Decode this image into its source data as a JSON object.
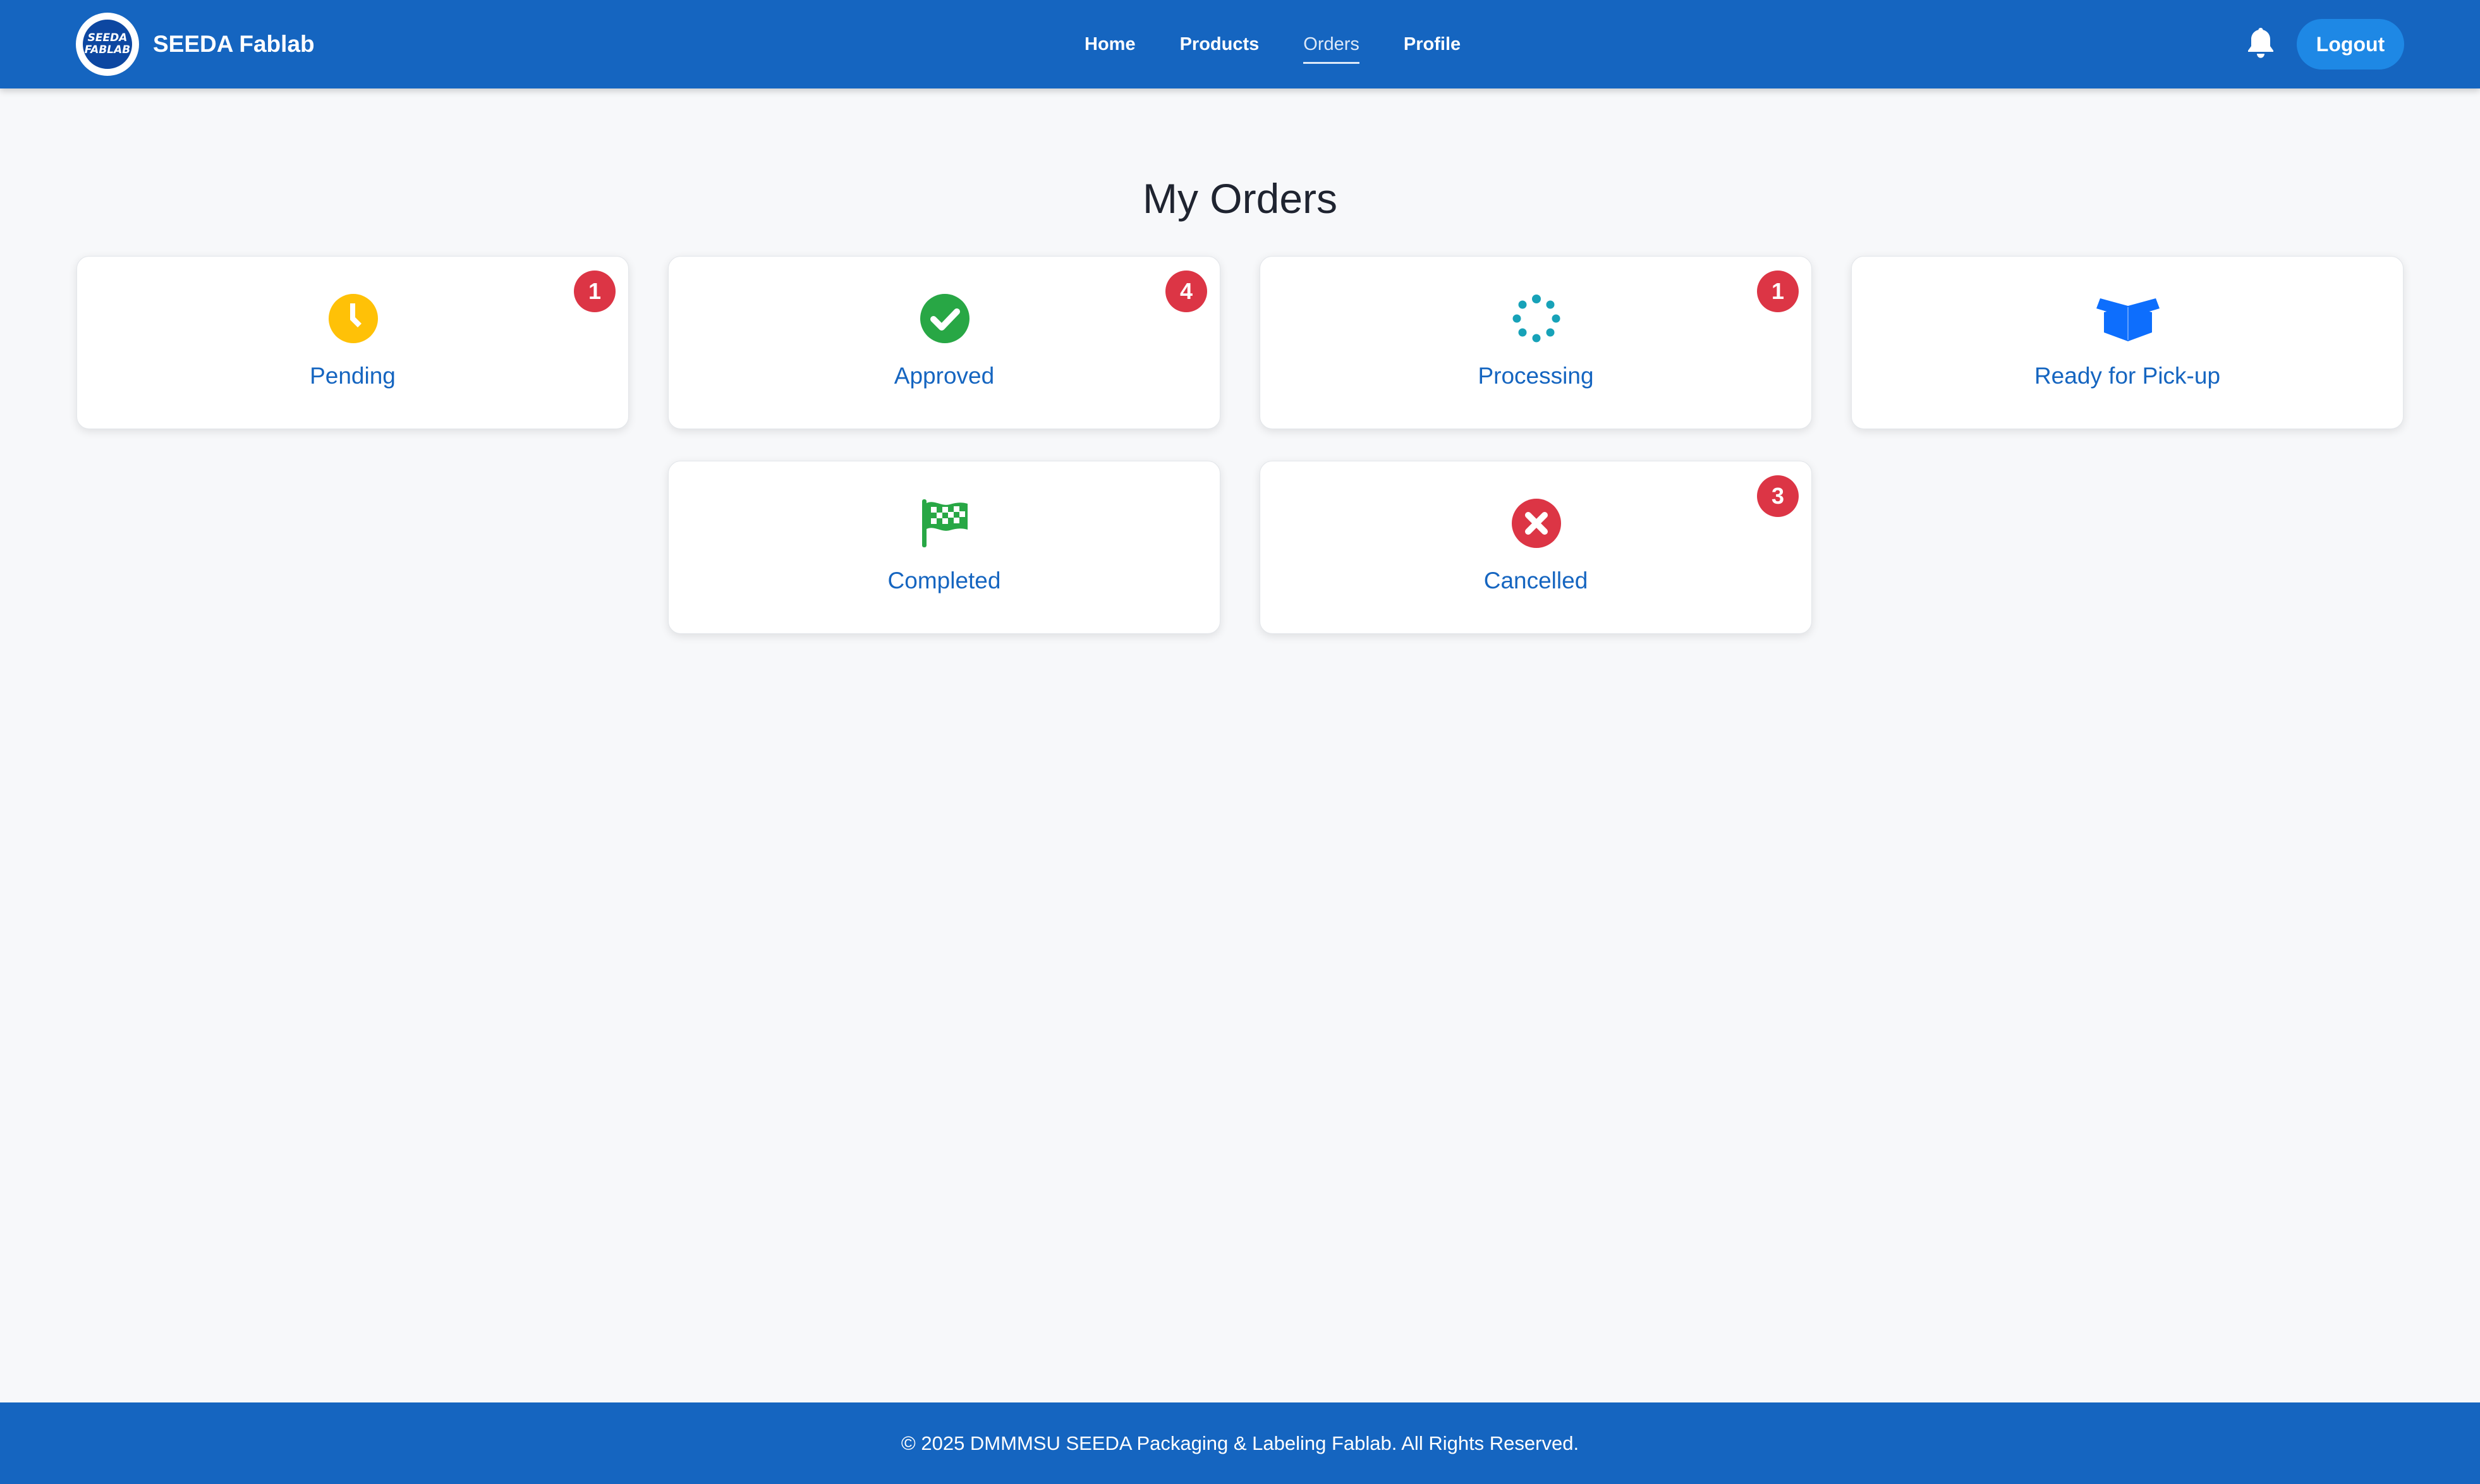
{
  "navbar": {
    "logo_line1": "SEEDA",
    "logo_line2": "FABLAB",
    "brand": "SEEDA Fablab",
    "links": [
      {
        "label": "Home"
      },
      {
        "label": "Products"
      },
      {
        "label": "Orders",
        "active": true
      },
      {
        "label": "Profile"
      }
    ],
    "logout_label": "Logout"
  },
  "main": {
    "title": "My Orders",
    "cards": [
      {
        "label": "Pending",
        "badge": "1",
        "icon": "clock-icon",
        "color": "#ffc107"
      },
      {
        "label": "Approved",
        "badge": "4",
        "icon": "check-circle-icon",
        "color": "#28a745"
      },
      {
        "label": "Processing",
        "badge": "1",
        "icon": "spinner-icon",
        "color": "#17a2b8"
      },
      {
        "label": "Ready for Pick-up",
        "badge": "",
        "icon": "box-open-icon",
        "color": "#0d6efd"
      },
      {
        "label": "Completed",
        "badge": "",
        "icon": "checkered-flag-icon",
        "color": "#28a745"
      },
      {
        "label": "Cancelled",
        "badge": "3",
        "icon": "x-circle-icon",
        "color": "#dc3545"
      }
    ]
  },
  "footer": {
    "text": "© 2025 DMMMSU SEEDA Packaging & Labeling Fablab. All Rights Reserved."
  },
  "colors": {
    "primary": "#1565c0",
    "logout_button": "#1e88e5",
    "badge": "#dc3545",
    "background": "#f7f8fa"
  }
}
